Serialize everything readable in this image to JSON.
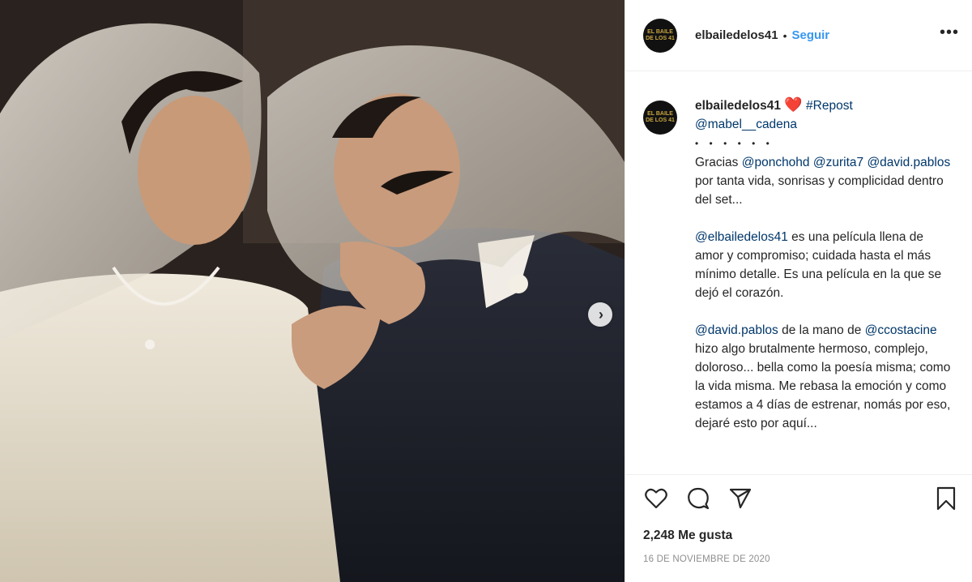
{
  "post": {
    "image_alt": "Pareja de novios con velo",
    "next_icon": "chevron-right-icon"
  },
  "header": {
    "avatar_text": "EL BAILE DE LOS 41",
    "username": "elbailedelos41",
    "separator": "•",
    "follow_label": "Seguir",
    "more_icon": "more-options-icon"
  },
  "caption": {
    "avatar_text": "EL BAILE DE LOS 41",
    "username": "elbailedelos41",
    "heart": "❤️",
    "hashtag": "#Repost",
    "mention_author": "@mabel__cadena",
    "dots": "• • • • • •",
    "p1_prefix": "Gracias ",
    "p1_m1": "@ponchohd",
    "p1_m2": "@zurita7",
    "p1_m3": "@david.pablos",
    "p1_suffix": " por tanta vida, sonrisas y complicidad dentro del set...",
    "p2_m1": "@elbailedelos41",
    "p2_text": " es una película llena de amor y compromiso; cuidada hasta el más mínimo detalle. Es una película en la que se dejó el corazón.",
    "p3_m1": "@david.pablos",
    "p3_mid": " de la mano de ",
    "p3_m2": "@ccostacine",
    "p3_text": " hizo algo brutalmente hermoso, complejo, doloroso... bella como la poesía misma; como la vida misma. Me rebasa la emoción y como estamos a 4 días de estrenar, nomás por eso, dejaré esto por aquí..."
  },
  "actions": {
    "like_icon": "heart-icon",
    "comment_icon": "comment-icon",
    "share_icon": "share-icon",
    "save_icon": "bookmark-icon",
    "likes": "2,248 Me gusta",
    "date": "16 DE NOVIEMBRE DE 2020"
  },
  "colors": {
    "link": "#3897f0",
    "mention": "#00376b",
    "text": "#262626",
    "muted": "#8e8e8e"
  }
}
